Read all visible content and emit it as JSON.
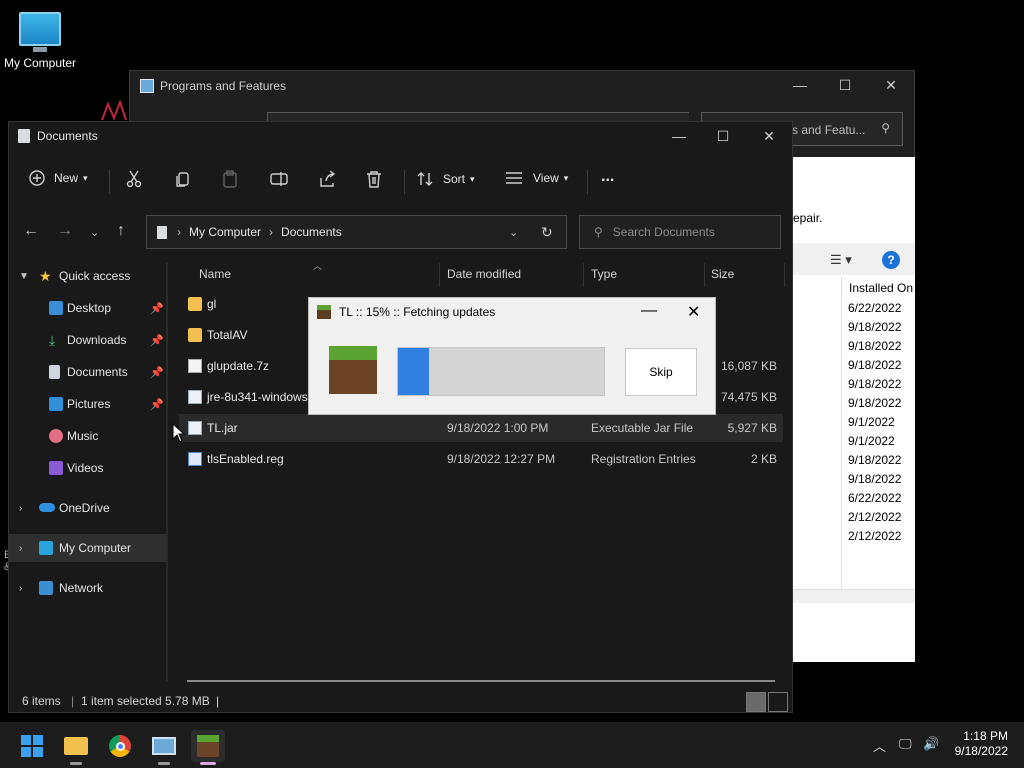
{
  "desktop": {
    "icon_label": "My Computer",
    "left_edge_text": [
      "E",
      "&"
    ]
  },
  "programs_window": {
    "title": "Programs and Features",
    "search_placeholder": "s and Featu...",
    "repair_text": "epair.",
    "column_header": "Installed On",
    "installed_dates": [
      "6/22/2022",
      "9/18/2022",
      "9/18/2022",
      "9/18/2022",
      "9/18/2022",
      "9/18/2022",
      "9/1/2022",
      "9/1/2022",
      "9/18/2022",
      "9/18/2022",
      "6/22/2022",
      "2/12/2022",
      "2/12/2022"
    ]
  },
  "explorer": {
    "title": "Documents",
    "toolbar": {
      "new_label": "New",
      "sort_label": "Sort",
      "view_label": "View",
      "more_label": "..."
    },
    "breadcrumb": [
      "My Computer",
      "Documents"
    ],
    "search_placeholder": "Search Documents",
    "sidebar": {
      "quick_access": "Quick access",
      "items": [
        "Desktop",
        "Downloads",
        "Documents",
        "Pictures",
        "Music",
        "Videos"
      ],
      "onedrive": "OneDrive",
      "my_computer": "My Computer",
      "network": "Network"
    },
    "columns": {
      "name": "Name",
      "date": "Date modified",
      "type": "Type",
      "size": "Size"
    },
    "files": [
      {
        "name": "gl",
        "date": "",
        "type": "",
        "size": ""
      },
      {
        "name": "TotalAV",
        "date": "",
        "type": "",
        "size": ""
      },
      {
        "name": "glupdate.7z",
        "date": "",
        "type": "",
        "size": "16,087 KB"
      },
      {
        "name": "jre-8u341-windows",
        "date": "",
        "type": "",
        "size": "74,475 KB"
      },
      {
        "name": "TL.jar",
        "date": "9/18/2022 1:00 PM",
        "type": "Executable Jar File",
        "size": "5,927 KB"
      },
      {
        "name": "tlsEnabled.reg",
        "date": "9/18/2022 12:27 PM",
        "type": "Registration Entries",
        "size": "2 KB"
      }
    ],
    "status": {
      "count": "6 items",
      "selection": "1 item selected  5.78 MB"
    }
  },
  "dialog": {
    "title": "TL :: 15% :: Fetching updates",
    "progress": 0.15,
    "skip_label": "Skip"
  },
  "taskbar": {
    "time": "1:18 PM",
    "date": "9/18/2022"
  },
  "colors": {
    "accent": "#2f80e0",
    "folder": "#f2c04f",
    "grass": "#5aa232"
  }
}
